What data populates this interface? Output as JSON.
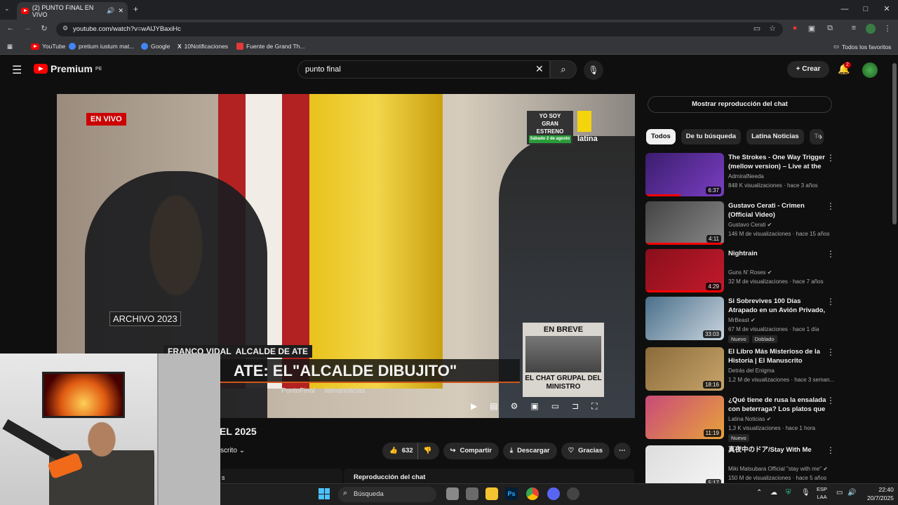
{
  "browser": {
    "tab_title": "(2) PUNTO FINAL EN VIVO",
    "url": "youtube.com/watch?v=wAlJYBaxiHc",
    "bookmarks": [
      "YouTube",
      "pretium iustum mat...",
      "Google",
      "10Notificaciones",
      "Fuente de Grand Th..."
    ],
    "all_bookmarks": "Todos los favoritos",
    "new_tab": "+",
    "minimize": "—",
    "maximize": "□",
    "close": "✕"
  },
  "youtube": {
    "logo": "Premium",
    "region": "PE",
    "search_value": "punto final",
    "create_label": "Crear",
    "notif_count": "2"
  },
  "video": {
    "live_badge": "EN VIVO",
    "archive_label": "ARCHIVO 2023",
    "name_tag": "FRANCO VIDAL",
    "role_tag": "ALCALDE DE ATE",
    "headline": "ATE: EL\"ALCALDE DIBUJITO\"",
    "social_1": "PuntoFinal",
    "social_2": "latinanoticias",
    "promo_1": "YO SOY",
    "promo_2": "GRAN ESTRENO",
    "promo_3": "Sábado 2 de agosto",
    "channel_logo": "latina",
    "brief_title": "EN BREVE",
    "brief_text": "EL CHAT GRUPAL DEL MINISTRO",
    "title_fragment": "EL 2025",
    "subscribe_fragment": "scrito",
    "likes": "632",
    "share": "Compartir",
    "download": "Descargar",
    "thanks": "Gracias",
    "chat_replay_bar": "Reproducción del chat",
    "left_fragment": "s"
  },
  "sidebar": {
    "chat_button": "Mostrar reproducción del chat",
    "chips": [
      "Todos",
      "De tu búsqueda",
      "Latina Noticias",
      "Te"
    ],
    "recs": [
      {
        "title": "The Strokes - One Way Trigger (mellow version) – Live at the ...",
        "channel": "AdmiralNeeda",
        "views": "848 K visualizaciones · hace 3 años",
        "duration": "6:37",
        "badges": [],
        "progress": 0.45,
        "color1": "#3b1d6e",
        "color2": "#7a3ec2"
      },
      {
        "title": "Gustavo Cerati - Crimen (Official Video)",
        "channel": "Gustavo Cerati ✔",
        "views": "146 M de visualizaciones · hace 15 años",
        "duration": "4:11",
        "badges": [],
        "progress": 1.0,
        "color1": "#444",
        "color2": "#888"
      },
      {
        "title": "Nightrain",
        "channel": "Guns N' Roses ✔",
        "views": "32 M de visualizaciones · hace 7 años",
        "duration": "4:29",
        "badges": [],
        "progress": 1.0,
        "color1": "#8a0f1b",
        "color2": "#c21a2c"
      },
      {
        "title": "Si Sobrevives 100 Días Atrapado en un Avión Privado, ...",
        "channel": "MrBeast ✔",
        "views": "67 M de visualizaciones · hace 1 día",
        "duration": "33:03",
        "badges": [
          "Nuevo",
          "Doblado"
        ],
        "progress": 0,
        "color1": "#4a6f8a",
        "color2": "#c9d5de"
      },
      {
        "title": "El Libro Más Misterioso de la Historia | El Manuscrito Voynich",
        "channel": "Detrás del Enigma",
        "views": "1,2 M de visualizaciones · hace 3 seman...",
        "duration": "18:16",
        "badges": [],
        "progress": 0,
        "color1": "#8a6b3a",
        "color2": "#c8a46a"
      },
      {
        "title": "¿Qué tiene de rusa la ensalada con beterraga? Los platos que ...",
        "channel": "Latina Noticias ✔",
        "views": "1,3 K visualizaciones · hace 1 hora",
        "duration": "11:19",
        "badges": [
          "Nuevo"
        ],
        "progress": 0,
        "color1": "#c94a7a",
        "color2": "#e8a23a"
      },
      {
        "title": "真夜中のドア/Stay With Me",
        "channel": "Miki Matsubara Official \"stay with me\" ✔",
        "views": "150 M de visualizaciones · hace 5 años",
        "duration": "5:17",
        "badges": [],
        "progress": 0,
        "color1": "#ddd",
        "color2": "#f5f5f5"
      }
    ]
  },
  "taskbar": {
    "search_placeholder": "Búsqueda",
    "lang1": "ESP",
    "lang2": "LAA",
    "time": "22:40",
    "date": "20/7/2025"
  }
}
